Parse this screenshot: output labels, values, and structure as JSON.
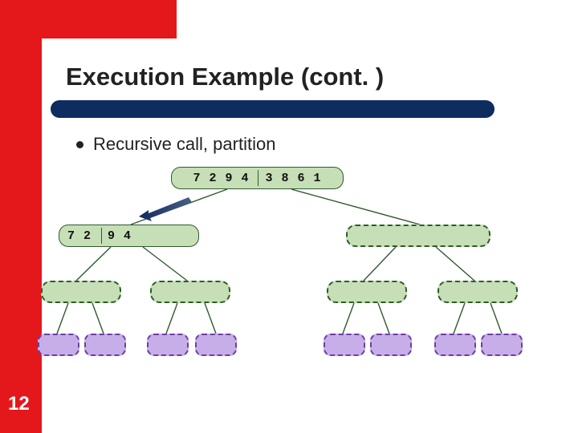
{
  "slide": {
    "title": "Execution Example (cont. )",
    "bullet": "Recursive call, partition",
    "page_number": "12"
  },
  "colors": {
    "accent_red": "#e4171b",
    "bar_blue": "#0e2c60",
    "node_green_fill": "#c6dfb6",
    "node_green_border": "#2e5a2e",
    "node_purple_fill": "#c7aee8",
    "node_purple_border": "#6b3fa0"
  },
  "tree": {
    "root": {
      "text": "7 2 9 4  3 8 6 1",
      "divider": true,
      "style": "solid"
    },
    "level1": [
      {
        "text": "7 2  9 4",
        "divider": true,
        "style": "solid"
      },
      {
        "text": "",
        "divider": false,
        "style": "dashed-g"
      }
    ],
    "level2": [
      {
        "text": "",
        "style": "dashed-g"
      },
      {
        "text": "",
        "style": "dashed-g"
      },
      {
        "text": "",
        "style": "dashed-g"
      },
      {
        "text": "",
        "style": "dashed-g"
      }
    ],
    "level3": [
      {
        "text": "",
        "style": "dashed-p"
      },
      {
        "text": "",
        "style": "dashed-p"
      },
      {
        "text": "",
        "style": "dashed-p"
      },
      {
        "text": "",
        "style": "dashed-p"
      },
      {
        "text": "",
        "style": "dashed-p"
      },
      {
        "text": "",
        "style": "dashed-p"
      },
      {
        "text": "",
        "style": "dashed-p"
      },
      {
        "text": "",
        "style": "dashed-p"
      }
    ]
  }
}
